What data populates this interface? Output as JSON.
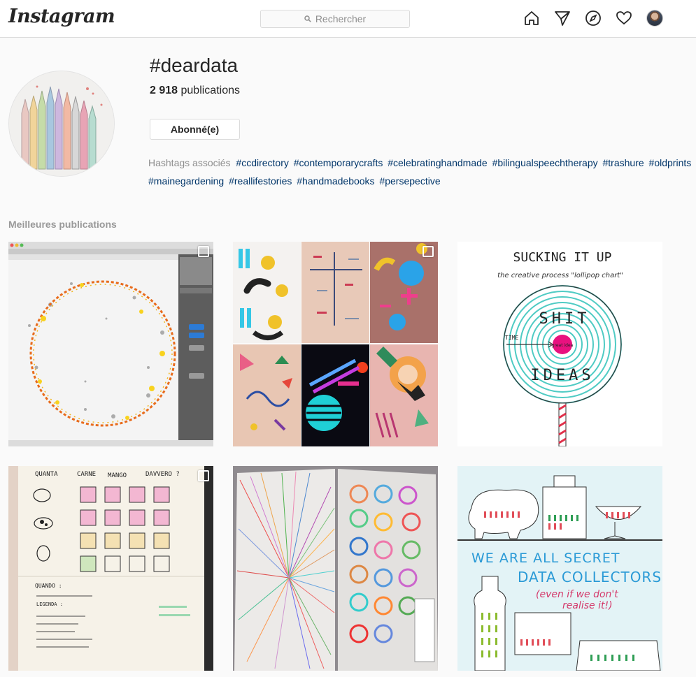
{
  "header": {
    "logo": "Instagram",
    "search_placeholder": "Rechercher",
    "nav_icons": [
      "home-icon",
      "direct-icon",
      "explore-icon",
      "activity-icon",
      "profile-avatar"
    ]
  },
  "tag": {
    "name": "#deardata",
    "count": "2 918",
    "count_label": "publications",
    "follow_label": "Abonné(e)"
  },
  "related": {
    "label": "Hashtags associés",
    "tags": [
      "#ccdirectory",
      "#contemporarycrafts",
      "#celebratinghandmade",
      "#bilingualspeechtherapy",
      "#trashure",
      "#oldprints",
      "#mainegardening",
      "#reallifestories",
      "#handmadebooks",
      "#persepective"
    ]
  },
  "top_posts": {
    "title": "Meilleures publications",
    "posts": [
      {
        "kind": "nodebox-screenshot",
        "multi": true
      },
      {
        "kind": "pattern-collage",
        "multi": true
      },
      {
        "kind": "lollipop-chart",
        "multi": false,
        "title": "SUCKING IT UP",
        "subtitle": "the creative process \"lollipop chart\"",
        "words": [
          "SHIT",
          "IDEAS"
        ],
        "time_label": "TIME",
        "center_label": "great idea"
      },
      {
        "kind": "notebook-sketch",
        "multi": true,
        "headers": [
          "QUANTA",
          "CARNE",
          "MANGO",
          "DAVVERO ?"
        ],
        "footer": "QUANDO :",
        "legend": "LEGENDA :"
      },
      {
        "kind": "radial-notebook",
        "multi": false
      },
      {
        "kind": "data-collectors",
        "multi": false,
        "headline": [
          "WE ARE ALL SECRET",
          "DATA COLLECTORS",
          "(even if we don't",
          "realise it!)"
        ]
      }
    ]
  },
  "colors": {
    "link": "#003569",
    "border": "#dbdbdb",
    "muted": "#8e8e8e",
    "bg": "#fafafa"
  }
}
